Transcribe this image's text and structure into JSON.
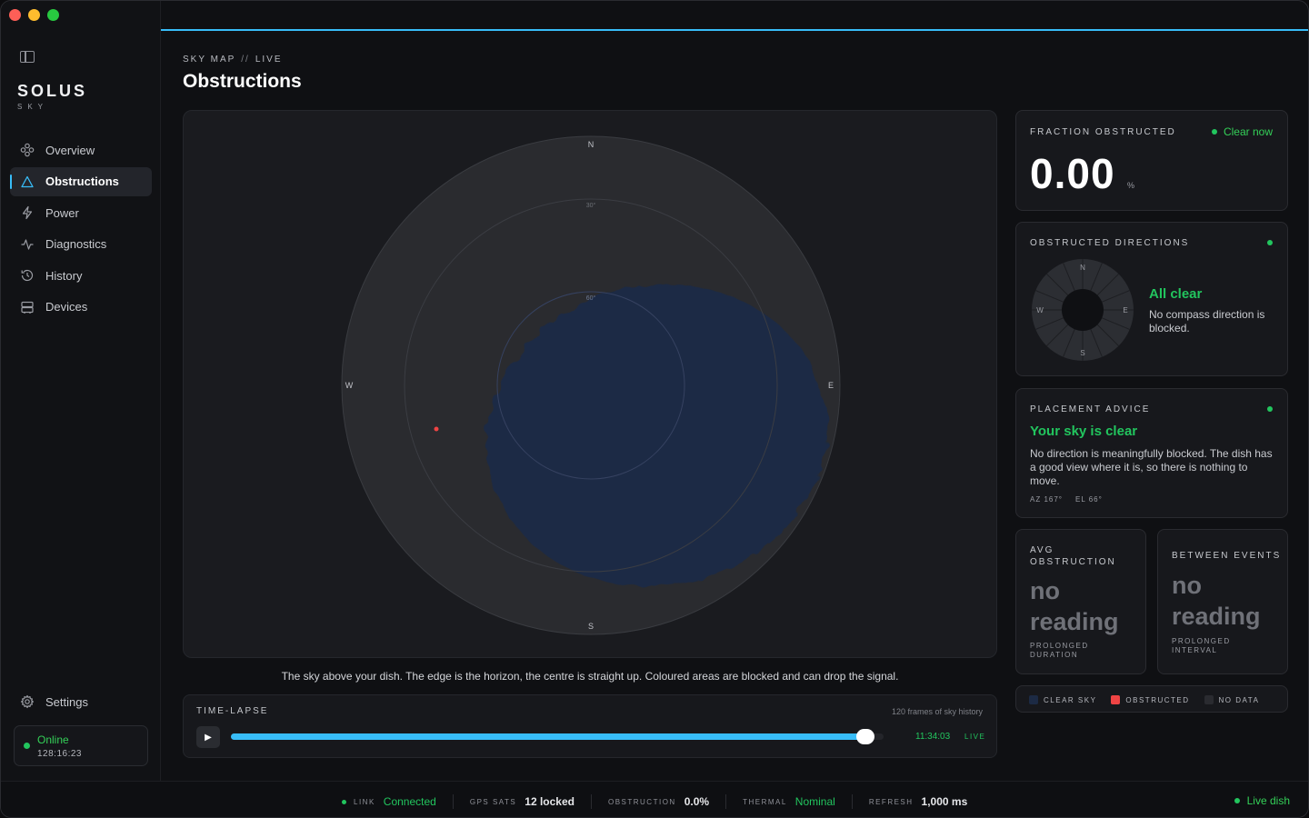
{
  "sidebar": {
    "brand": "SOLUS",
    "brand_sub": "SKY",
    "items": [
      {
        "label": "Overview",
        "icon": "overview-icon"
      },
      {
        "label": "Obstructions",
        "icon": "triangle-icon"
      },
      {
        "label": "Power",
        "icon": "bolt-icon"
      },
      {
        "label": "Diagnostics",
        "icon": "pulse-icon"
      },
      {
        "label": "History",
        "icon": "history-icon"
      },
      {
        "label": "Devices",
        "icon": "devices-icon"
      }
    ],
    "settings_label": "Settings",
    "status": {
      "label": "Online",
      "uptime": "128:16:23"
    }
  },
  "header": {
    "crumb_section": "SKY MAP",
    "crumb_sep": "//",
    "crumb_mode": "LIVE",
    "title": "Obstructions"
  },
  "sky_map": {
    "labels": {
      "n": "N",
      "s": "S",
      "e": "E",
      "w": "W",
      "ring30": "30°",
      "ring60": "60°"
    },
    "caption": "The sky above your dish. The edge is the horizon, the centre is straight up. Coloured areas are blocked and can drop the signal."
  },
  "timelapse": {
    "title": "TIME-LAPSE",
    "frames": "120 frames of sky history",
    "progress": 0.985,
    "time": "11:34:03",
    "live_label": "LIVE"
  },
  "fraction": {
    "label": "FRACTION OBSTRUCTED",
    "status": "Clear now",
    "value": "0.00",
    "unit": "%"
  },
  "directions": {
    "label": "OBSTRUCTED DIRECTIONS",
    "compass": {
      "n": "N",
      "e": "E",
      "s": "S",
      "w": "W"
    },
    "title": "All clear",
    "text": "No compass direction is blocked."
  },
  "advice": {
    "label": "PLACEMENT ADVICE",
    "title": "Your sky is clear",
    "text": "No direction is meaningfully blocked. The dish has a good view where it is, so there is nothing to move.",
    "az": "AZ 167°",
    "el": "EL 66°"
  },
  "avg": {
    "label_line1": "AVG",
    "label_line2": "OBSTRUCTION",
    "value_line1": "no",
    "value_line2": "reading",
    "sub_line1": "PROLONGED",
    "sub_line2": "DURATION"
  },
  "between": {
    "label": "BETWEEN EVENTS",
    "value_line1": "no",
    "value_line2": "reading",
    "sub_line1": "PROLONGED",
    "sub_line2": "INTERVAL"
  },
  "legend": [
    {
      "label": "CLEAR SKY",
      "color": "#1c2a44"
    },
    {
      "label": "OBSTRUCTED",
      "color": "#ef4444"
    },
    {
      "label": "NO DATA",
      "color": "#2a2b30"
    }
  ],
  "statusbar": {
    "link_key": "LINK",
    "link_val": "Connected",
    "gps_key": "GPS SATS",
    "gps_val": "12 locked",
    "obs_key": "OBSTRUCTION",
    "obs_val": "0.0%",
    "thermal_key": "THERMAL",
    "thermal_val": "Nominal",
    "refresh_key": "REFRESH",
    "refresh_val": "1,000 ms",
    "live_dish": "Live dish"
  },
  "colors": {
    "accent": "#38bdf8",
    "ok": "#22c55e",
    "clear_sky": "#1c2a44",
    "obstructed": "#ef4444"
  }
}
